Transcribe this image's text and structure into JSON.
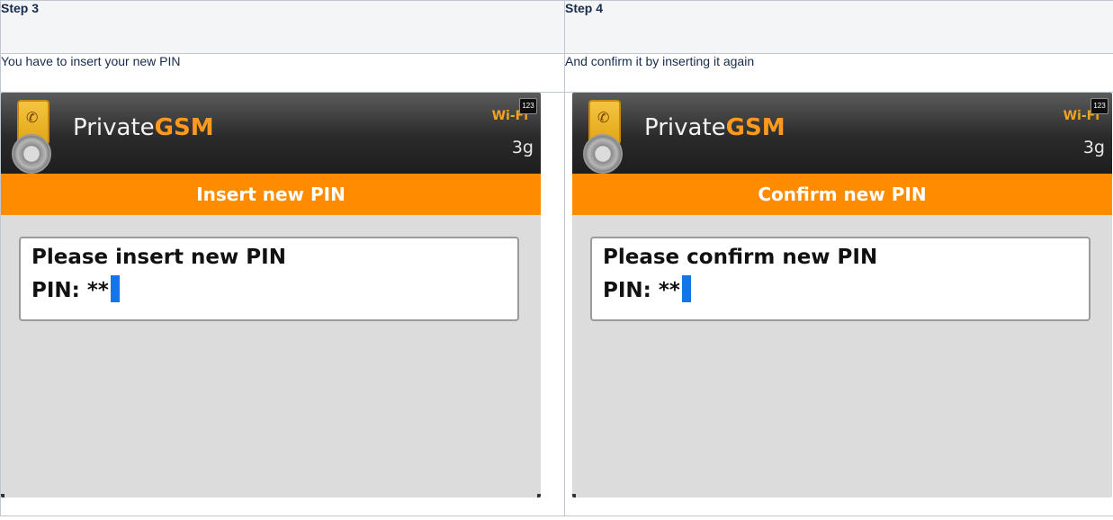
{
  "steps": [
    {
      "header": "Step 3",
      "description": "You have to insert your new PIN",
      "screen": {
        "brand_prefix": "Private",
        "brand_suffix": "GSM",
        "wifi": "Wi-Fi",
        "badge": "123",
        "network": "3g",
        "title": "Insert new PIN",
        "prompt": "Please insert new PIN",
        "pin_label": "PIN:",
        "pin_value": "**"
      }
    },
    {
      "header": "Step 4",
      "description": "And confirm it by inserting it again",
      "screen": {
        "brand_prefix": "Private",
        "brand_suffix": "GSM",
        "wifi": "Wi-Fi",
        "badge": "123",
        "network": "3g",
        "title": "Confirm new PIN",
        "prompt": "Please confirm new PIN",
        "pin_label": "PIN:",
        "pin_value": "**"
      }
    }
  ],
  "colors": {
    "accent": "#ff8c00",
    "cursor": "#1476e6",
    "brand_highlight": "#ff9a1f"
  }
}
